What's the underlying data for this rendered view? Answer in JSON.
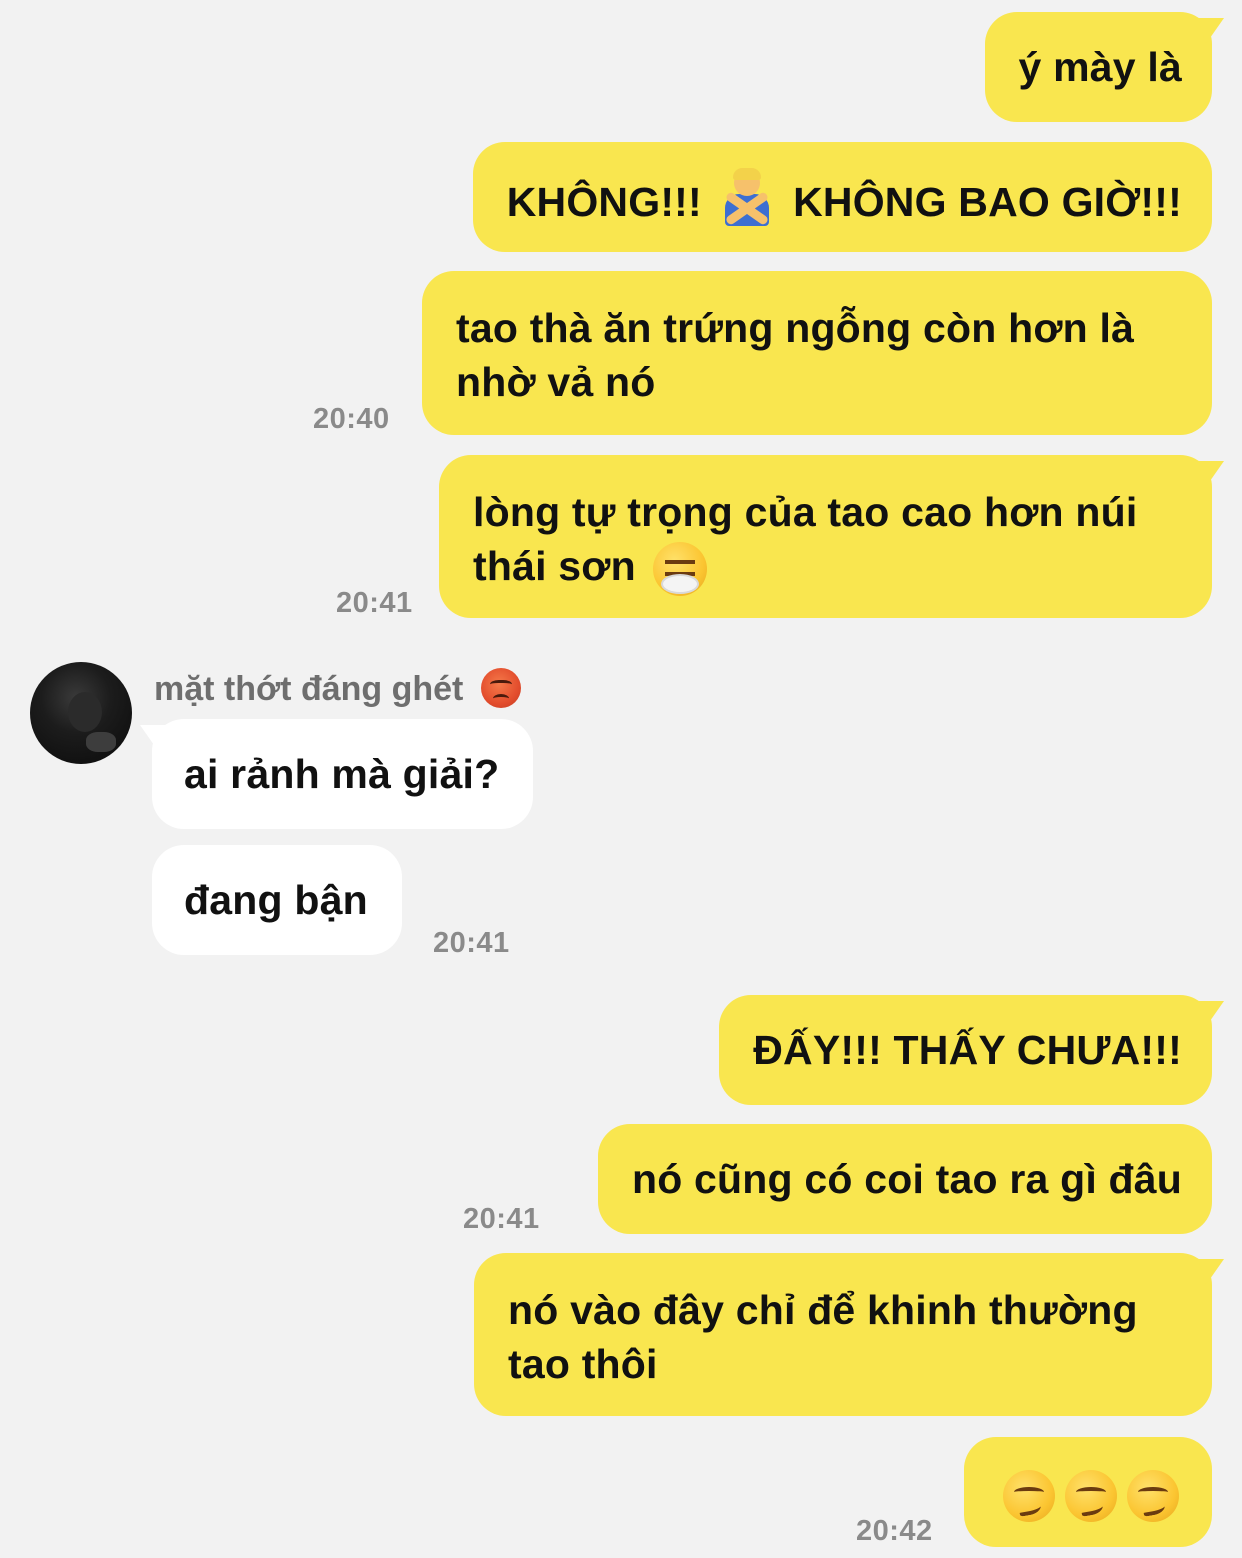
{
  "conversation": {
    "contact": {
      "name": "mặt thớt đáng ghét",
      "name_emoji": "angry-face-icon"
    },
    "messages": [
      {
        "from": "me",
        "text": "ý mày là"
      },
      {
        "from": "me",
        "text_parts": [
          "KHÔNG!!!",
          "KHÔNG BAO GIỜ!!!"
        ],
        "emoji": "person-gesturing-no-icon"
      },
      {
        "from": "me",
        "text": "tao thà ăn trứng ngỗng còn hơn là nhờ vả nó",
        "time": "20:40"
      },
      {
        "from": "me",
        "text": "lòng tự trọng của tao cao hơn núi thái sơn",
        "emoji": "face-with-steam-icon",
        "time": "20:41"
      },
      {
        "from": "them",
        "text": "ai rảnh mà giải?"
      },
      {
        "from": "them",
        "text": "đang bận",
        "time": "20:41"
      },
      {
        "from": "me",
        "text": "ĐẤY!!! THẤY CHƯA!!!"
      },
      {
        "from": "me",
        "text": "nó cũng có coi tao ra gì đâu",
        "time": "20:41"
      },
      {
        "from": "me",
        "text": "nó vào đây chỉ để khinh thường tao thôi"
      },
      {
        "from": "me",
        "emoji_row": [
          "smirking-face-icon",
          "smirking-face-icon",
          "smirking-face-icon"
        ],
        "time": "20:42"
      }
    ]
  },
  "colors": {
    "background": "#f2f2f2",
    "my_bubble": "#f9e64f",
    "their_bubble": "#ffffff",
    "timestamp": "#8a8a8a",
    "sender_name": "#6e6e6e"
  }
}
